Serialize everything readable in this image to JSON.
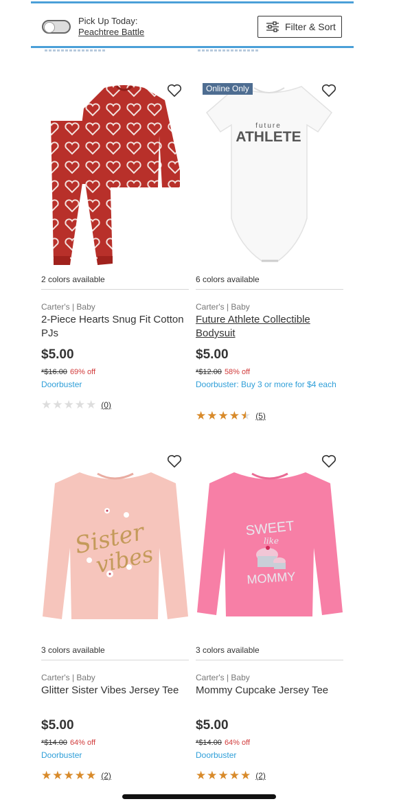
{
  "header": {
    "pickup_label": "Pick Up Today:",
    "store_name": "Peachtree Battle",
    "filter_label": "Filter & Sort"
  },
  "products": [
    {
      "colors": "2 colors available",
      "brand": "Carter's | Baby",
      "name": "2-Piece Hearts Snug Fit Cotton PJs",
      "price": "$5.00",
      "original_price": "*$16.00",
      "discount": "69% off",
      "promo": "Doorbuster",
      "rating_stars": 0,
      "review_count": "(0)"
    },
    {
      "badge": "Online Only",
      "colors": "6 colors available",
      "brand": "Carter's | Baby",
      "name": "Future Athlete Collectible Bodysuit",
      "price": "$5.00",
      "original_price": "*$12.00",
      "discount": "58% off",
      "promo": "Doorbuster: Buy 3 or more for $4 each",
      "rating_stars": 4.5,
      "review_count": "(5)",
      "graphic_text_small": "future",
      "graphic_text_large": "ATHLETE"
    },
    {
      "colors": "3 colors available",
      "brand": "Carter's | Baby",
      "name": "Glitter Sister Vibes Jersey Tee",
      "price": "$5.00",
      "original_price": "*$14.00",
      "discount": "64% off",
      "promo": "Doorbuster",
      "rating_stars": 5,
      "review_count": "(2)",
      "graphic_text_1": "Sister",
      "graphic_text_2": "vibes"
    },
    {
      "colors": "3 colors available",
      "brand": "Carter's | Baby",
      "name": "Mommy Cupcake Jersey Tee",
      "price": "$5.00",
      "original_price": "*$14.00",
      "discount": "64% off",
      "promo": "Doorbuster",
      "rating_stars": 5,
      "review_count": "(2)",
      "graphic_text_1": "SWEET",
      "graphic_text_2": "like",
      "graphic_text_3": "MOMMY"
    }
  ],
  "icons": {
    "filter": "sliders-icon",
    "wishlist": "heart-outline-icon",
    "star": "star-icon"
  },
  "colors": {
    "accent_blue": "#4a9fd8",
    "promo_blue": "#2e9ed8",
    "discount_red": "#d13b3b",
    "star_gold": "#d88a2a",
    "badge_bg": "#4e6d91"
  }
}
